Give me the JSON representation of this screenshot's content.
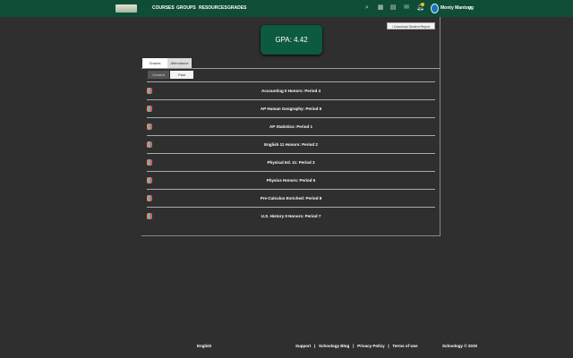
{
  "header": {
    "nav": [
      "COURSES",
      "GROUPS",
      "RESOURCES",
      "GRADES"
    ],
    "user": "Monty Mantong"
  },
  "download_label": "Download Student Report",
  "gpa": "GPA: 4.42",
  "tabs": [
    "Grades",
    "Attendance"
  ],
  "subtabs": [
    "Current",
    "Past"
  ],
  "courses": [
    "Accounting II Honors: Period 4",
    "AP Human Geography: Period 6",
    "AP Statistics: Period 1",
    "English 11 Honors: Period 2",
    "Physical Ed. 11: Period 3",
    "Physics Honors: Period 5",
    "Pre-Calculus Enriched: Period 8",
    "U.S. History II Honors: Period 7"
  ],
  "footer": {
    "language": "English",
    "links": [
      "Support",
      "|",
      "Schoology Blog",
      "|",
      "Privacy Policy",
      "|",
      "Terms of Use"
    ],
    "copyright": "Schoology © 2019"
  },
  "colors": {
    "header": "#0f4d36",
    "gpa": "#0c5a40",
    "background": "#2f2f2f"
  }
}
